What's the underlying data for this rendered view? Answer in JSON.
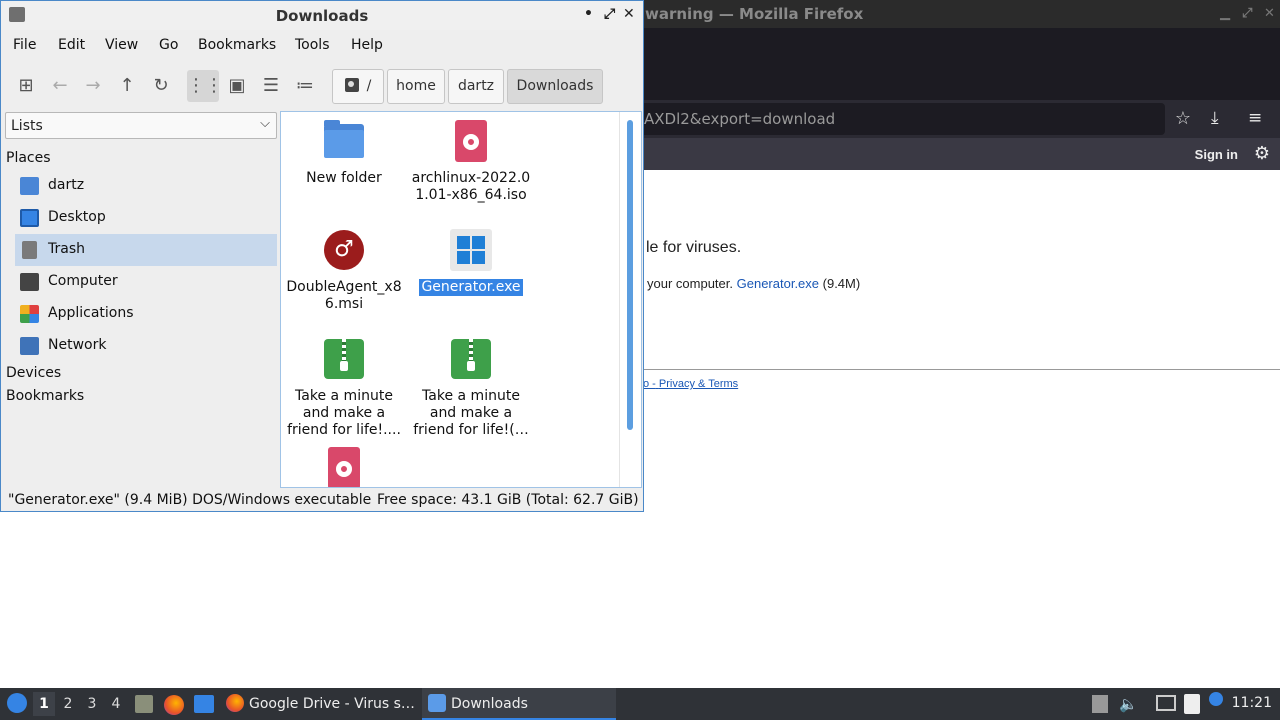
{
  "firefox": {
    "title": "warning — Mozilla Firefox",
    "url_partial": "AXDl2&export=download",
    "sign_in": "Sign in",
    "message_partial": "le for viruses.",
    "download_prefix": "your computer.",
    "download_link": "Generator.exe",
    "download_size": "(9.4M)",
    "footer_sep": "o -",
    "footer_link": "Privacy & Terms"
  },
  "filemanager": {
    "title": "Downloads",
    "window_buttons": {
      "minimize": "•",
      "maximize": "⤢",
      "close": "✕"
    },
    "menu": [
      "File",
      "Edit",
      "View",
      "Go",
      "Bookmarks",
      "Tools",
      "Help"
    ],
    "breadcrumb": {
      "root": "/",
      "items": [
        "home",
        "dartz",
        "Downloads"
      ]
    },
    "side_pane_mode": "Lists",
    "sections": {
      "places": "Places",
      "devices": "Devices",
      "bookmarks": "Bookmarks"
    },
    "places": [
      {
        "label": "dartz",
        "icon": "home-folder-icon",
        "color": "#4a86d6"
      },
      {
        "label": "Desktop",
        "icon": "desktop-icon",
        "color": "#3584e4"
      },
      {
        "label": "Trash",
        "icon": "trash-icon",
        "color": "#7a7a7a",
        "selected": true
      },
      {
        "label": "Computer",
        "icon": "computer-icon",
        "color": "#444444"
      },
      {
        "label": "Applications",
        "icon": "applications-icon",
        "color": "#e06030"
      },
      {
        "label": "Network",
        "icon": "network-icon",
        "color": "#3f73b8"
      }
    ],
    "files": [
      {
        "label": "New folder",
        "icon": "folder-icon"
      },
      {
        "label": "archlinux-2022.01.01-x86_64.iso",
        "display": "archlinux-2022.0\n1.01-x86_64.iso",
        "icon": "disc-image-icon"
      },
      {
        "label": "DoubleAgent_x86.msi",
        "display": "DoubleAgent_x8\n6.msi",
        "icon": "wine-icon"
      },
      {
        "label": "Generator.exe",
        "display": "Generator.exe",
        "icon": "windows-exe-icon",
        "selected": true
      },
      {
        "label": "Take a minute and make a friend for life!....",
        "display": "Take a minute\nand make a\nfriend for life!....",
        "icon": "zip-archive-icon"
      },
      {
        "label": "Take a minute and make a friend for life!(...",
        "display": "Take a minute\nand make a\nfriend for life!(…",
        "icon": "zip-archive-icon"
      },
      {
        "label": "",
        "display": "",
        "icon": "disc-image-icon"
      }
    ],
    "status_left": "\"Generator.exe\" (9.4 MiB) DOS/Windows executable",
    "status_right": "Free space: 43.1 GiB (Total: 62.7 GiB)"
  },
  "taskbar": {
    "workspaces": [
      "1",
      "2",
      "3",
      "4"
    ],
    "current_workspace": "1",
    "tasks": [
      {
        "label": "Google Drive - Virus s…",
        "icon": "firefox-icon"
      },
      {
        "label": "Downloads",
        "icon": "folder-icon",
        "active": true
      }
    ],
    "clock": "11:21"
  },
  "colors": {
    "accent": "#3584e4",
    "selection": "#c7d8ec",
    "taskbar": "#2f3237"
  }
}
